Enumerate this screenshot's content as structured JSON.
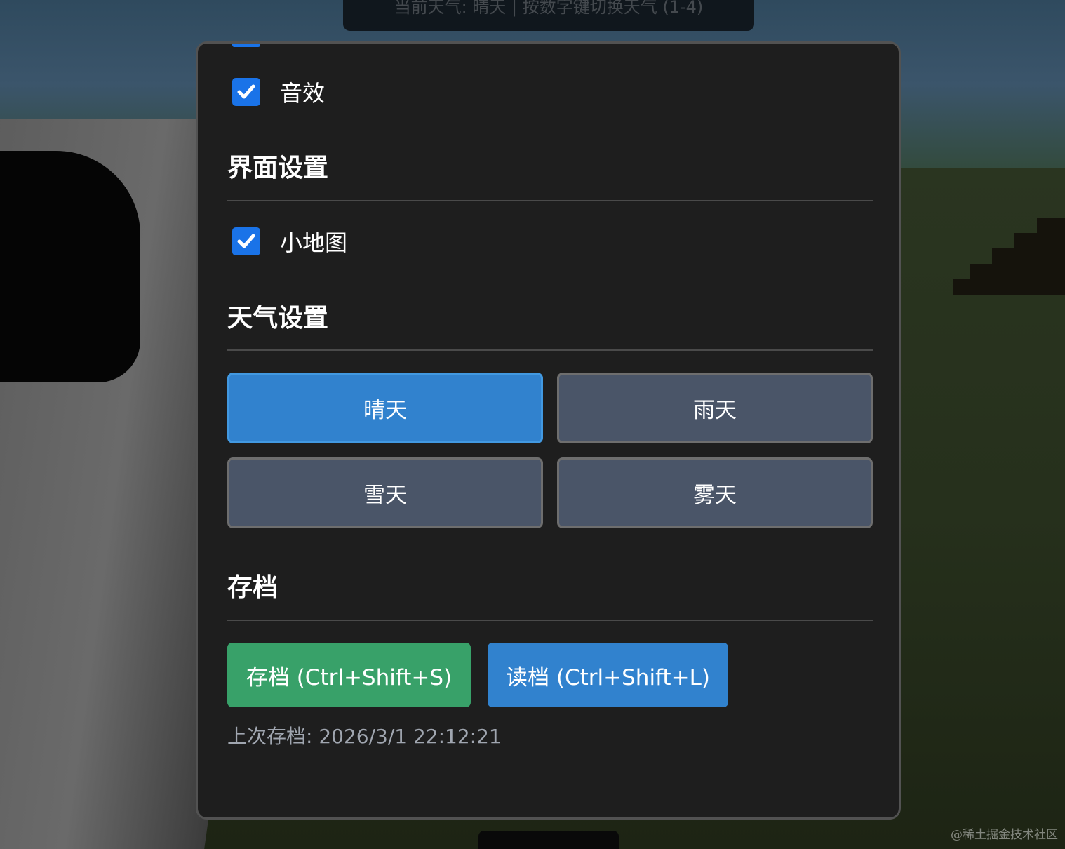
{
  "background": {
    "weather_banner_text": "当前天气: 晴天 | 按数字键切换天气 (1-4)",
    "watermark": "@稀土掘金技术社区"
  },
  "settings_panel": {
    "sound": {
      "label": "音效",
      "checked": true
    },
    "ui_settings": {
      "title": "界面设置",
      "minimap": {
        "label": "小地图",
        "checked": true
      }
    },
    "weather_settings": {
      "title": "天气设置",
      "options": [
        {
          "label": "晴天",
          "active": true
        },
        {
          "label": "雨天",
          "active": false
        },
        {
          "label": "雪天",
          "active": false
        },
        {
          "label": "雾天",
          "active": false
        }
      ]
    },
    "save_section": {
      "title": "存档",
      "save_button": "存档 (Ctrl+Shift+S)",
      "load_button": "读档 (Ctrl+Shift+L)",
      "last_save": "上次存档: 2026/3/1 22:12:21"
    }
  },
  "colors": {
    "panel_bg": "#1e1e1e",
    "checkbox": "#1a73e8",
    "active_button": "#3182ce",
    "inactive_button": "#4a5568",
    "save_button": "#38a169",
    "load_button": "#3182ce"
  }
}
